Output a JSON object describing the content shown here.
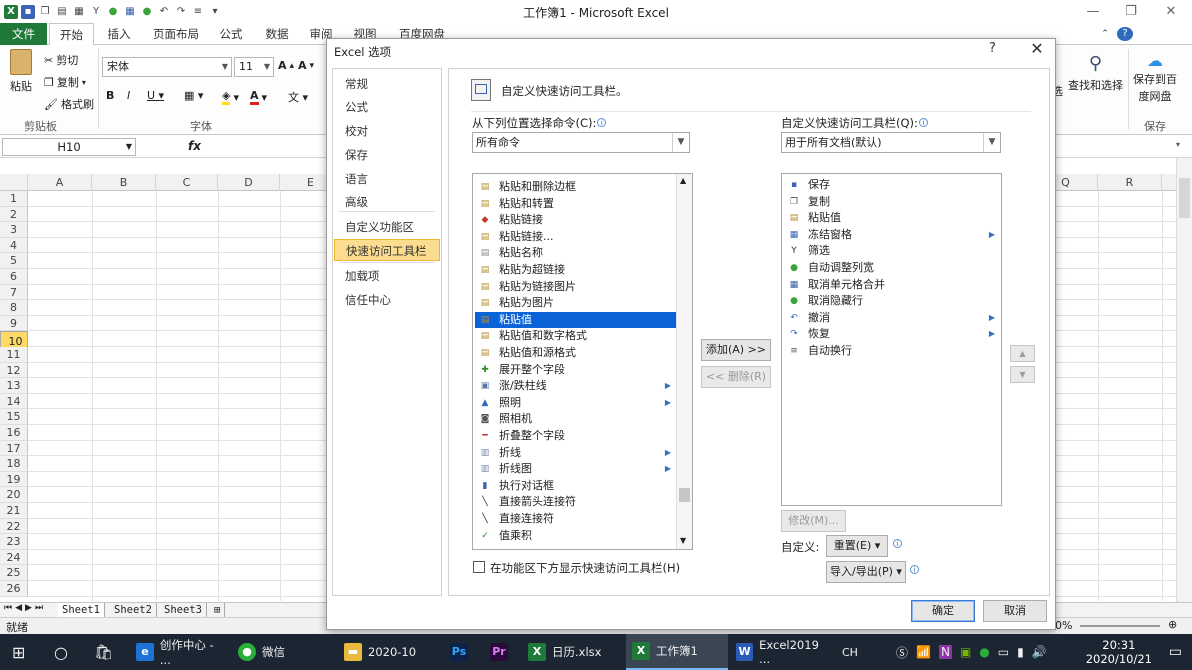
{
  "app": {
    "title": "工作簿1 - Microsoft Excel",
    "accent_green": "#1f7a3a"
  },
  "ribbon": {
    "tabs": [
      "文件",
      "开始",
      "插入",
      "页面布局",
      "公式",
      "数据",
      "审阅",
      "视图",
      "百度网盘"
    ],
    "active_tab": "开始",
    "clipboard": {
      "paste": "粘贴",
      "cut": "剪切",
      "copy": "复制",
      "format_painter": "格式刷",
      "group": "剪贴板"
    },
    "font": {
      "name": "宋体",
      "size": "11",
      "group": "字体"
    },
    "right_buttons": {
      "select_suffix": "选",
      "find_select": "查找和选择",
      "save_baidu_1": "保存到百",
      "save_baidu_2": "度网盘",
      "save_group": "保存"
    }
  },
  "formula_bar": {
    "name_box": "H10",
    "fx": "fx"
  },
  "sheet": {
    "columns": [
      "A",
      "B",
      "C",
      "D",
      "E",
      "Q",
      "R"
    ],
    "rows": [
      "1",
      "2",
      "3",
      "4",
      "5",
      "6",
      "7",
      "8",
      "9",
      "10",
      "11",
      "12",
      "13",
      "14",
      "15",
      "16",
      "17",
      "18",
      "19",
      "20",
      "21",
      "22",
      "23",
      "24",
      "25",
      "26"
    ],
    "selected_row": "10",
    "tabs": [
      "Sheet1",
      "Sheet2",
      "Sheet3"
    ],
    "status": "就绪",
    "zoom": "0%"
  },
  "dialog": {
    "title": "Excel 选项",
    "help": "?",
    "close": "✕",
    "nav": [
      "常规",
      "公式",
      "校对",
      "保存",
      "语言",
      "高级",
      "自定义功能区",
      "快速访问工具栏",
      "加载项",
      "信任中心"
    ],
    "active_nav": "快速访问工具栏",
    "heading": "自定义快速访问工具栏。",
    "choose_from_label": "从下列位置选择命令(C):",
    "choose_from_value": "所有命令",
    "customize_label": "自定义快速访问工具栏(Q):",
    "customize_value": "用于所有文档(默认)",
    "commands": [
      {
        "label": "粘贴和删除边框",
        "sub": false
      },
      {
        "label": "粘贴和转置",
        "sub": false
      },
      {
        "label": "粘贴链接",
        "sub": false
      },
      {
        "label": "粘贴链接...",
        "sub": false
      },
      {
        "label": "粘贴名称",
        "sub": false
      },
      {
        "label": "粘贴为超链接",
        "sub": false
      },
      {
        "label": "粘贴为链接图片",
        "sub": false
      },
      {
        "label": "粘贴为图片",
        "sub": false
      },
      {
        "label": "粘贴值",
        "sub": false
      },
      {
        "label": "粘贴值和数字格式",
        "sub": false
      },
      {
        "label": "粘贴值和源格式",
        "sub": false
      },
      {
        "label": "展开整个字段",
        "sub": false
      },
      {
        "label": "涨/跌柱线",
        "sub": true
      },
      {
        "label": "照明",
        "sub": true
      },
      {
        "label": "照相机",
        "sub": false
      },
      {
        "label": "折叠整个字段",
        "sub": false
      },
      {
        "label": "折线",
        "sub": true
      },
      {
        "label": "折线图",
        "sub": true
      },
      {
        "label": "执行对话框",
        "sub": false
      },
      {
        "label": "直接箭头连接符",
        "sub": false
      },
      {
        "label": "直接连接符",
        "sub": false
      },
      {
        "label": "值乘积",
        "sub": false
      }
    ],
    "selected_command": "粘贴值",
    "qat_items": [
      {
        "label": "保存",
        "sub": false
      },
      {
        "label": "复制",
        "sub": false
      },
      {
        "label": "粘贴值",
        "sub": false
      },
      {
        "label": "冻结窗格",
        "sub": true
      },
      {
        "label": "筛选",
        "sub": false
      },
      {
        "label": "自动调整列宽",
        "sub": false
      },
      {
        "label": "取消单元格合并",
        "sub": false
      },
      {
        "label": "取消隐藏行",
        "sub": false
      },
      {
        "label": "撤消",
        "sub": true
      },
      {
        "label": "恢复",
        "sub": true
      },
      {
        "label": "自动换行",
        "sub": false
      }
    ],
    "add_button": "添加(A) >>",
    "remove_button": "<< 删除(R)",
    "modify_button": "修改(M)...",
    "customizations_label": "自定义:",
    "reset_button": "重置(E) ▾",
    "import_export_button": "导入/导出(P) ▾",
    "show_below_ribbon": "在功能区下方显示快速访问工具栏(H)",
    "ok": "确定",
    "cancel": "取消"
  },
  "taskbar": {
    "items": [
      "创作中心 - ...",
      "微信",
      "2020-10",
      "日历.xlsx",
      "工作簿1",
      "Excel2019 ..."
    ],
    "active": "工作簿1",
    "ime": "CH",
    "time": "20:31",
    "date": "2020/10/21"
  }
}
